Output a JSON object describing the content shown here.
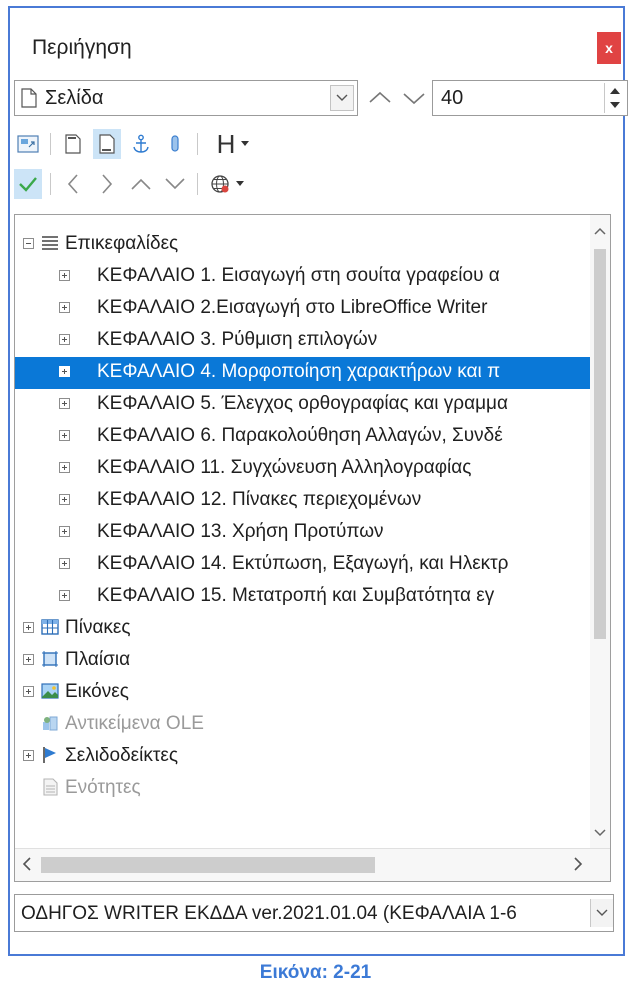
{
  "panel": {
    "title": "Περιήγηση",
    "close_label": "x"
  },
  "navigate_by": {
    "selected": "Σελίδα",
    "page_number": "40"
  },
  "toolbar2": {
    "heading_level_label": "H"
  },
  "tree": {
    "categories": {
      "headings": "Επικεφαλίδες",
      "tables": "Πίνακες",
      "frames": "Πλαίσια",
      "images": "Εικόνες",
      "ole_objects": "Αντικείμενα OLE",
      "bookmarks": "Σελιδοδείκτες",
      "sections": "Ενότητες"
    },
    "headings": [
      "ΚΕΦΑΛΑΙΟ 1. Εισαγωγή στη σουίτα γραφείου α",
      "ΚΕΦΑΛΑΙΟ 2.Εισαγωγή στο LibreOffice Writer",
      "ΚΕΦΑΛΑΙΟ 3. Ρύθμιση επιλογών",
      "ΚΕΦΑΛΑΙΟ 4. Μορφοποίηση χαρακτήρων και π",
      "ΚΕΦΑΛΑΙΟ 5. Έλεγχος ορθογραφίας και γραμμα",
      "ΚΕΦΑΛΑΙΟ 6. Παρακολούθηση Αλλαγών, Συνδέ",
      "ΚΕΦΑΛΑΙΟ 11. Συγχώνευση Αλληλογραφίας",
      "ΚΕΦΑΛΑΙΟ 12. Πίνακες περιεχομένων",
      "ΚΕΦΑΛΑΙΟ 13. Χρήση Προτύπων",
      "ΚΕΦΑΛΑΙΟ 14. Εκτύπωση, Εξαγωγή, και Ηλεκτρ",
      "ΚΕΦΑΛΑΙΟ 15. Μετατροπή και Συμβατότητα εγ"
    ],
    "selected_heading_index": 3
  },
  "document_selector": {
    "value": "ΟΔΗΓΟΣ WRITER ΕΚΔΔΑ ver.2021.01.04 (ΚΕΦΑΛΑΙΑ 1-6"
  },
  "caption": "Εικόνα: 2-21",
  "colors": {
    "selection": "#0a78d7",
    "close": "#e04343",
    "frame": "#4a7ad6",
    "caption": "#3c7ad6"
  }
}
